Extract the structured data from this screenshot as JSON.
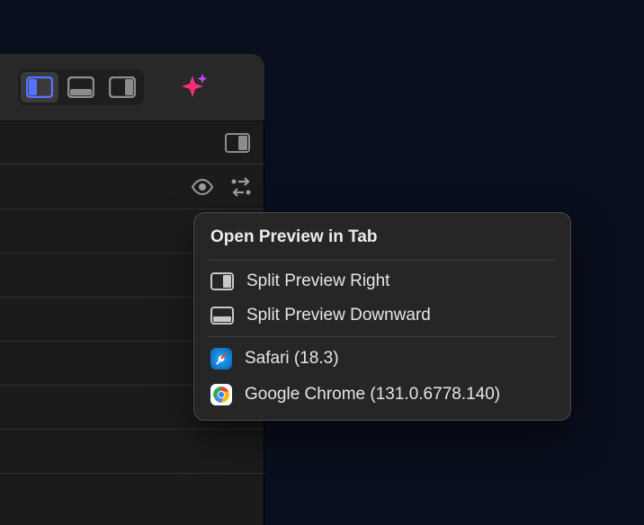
{
  "popover": {
    "header": "Open Preview in Tab",
    "split_right": "Split Preview Right",
    "split_down": "Split Preview Downward",
    "safari": "Safari (18.3)",
    "chrome": "Google Chrome (131.0.6778.140)"
  },
  "colors": {
    "accent_blue": "#5873ff",
    "sparkle": "#ff2d75"
  }
}
